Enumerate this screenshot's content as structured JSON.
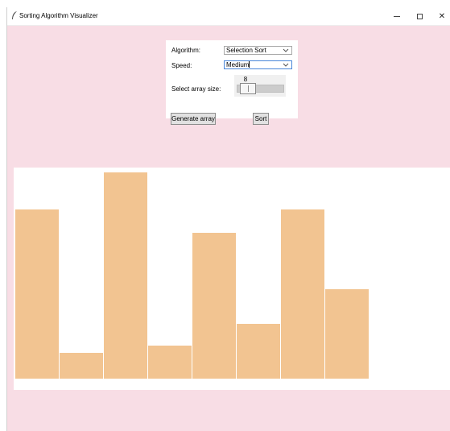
{
  "window": {
    "title": "Sorting Algorithm Visualizer",
    "icon": "feather-icon",
    "controls": {
      "minimize": "minimize-icon",
      "maximize": "maximize-icon",
      "close": "close-icon",
      "close_glyph": "✕"
    }
  },
  "controls": {
    "algorithm_label": "Algorithm:",
    "algorithm_value": "Selection Sort",
    "speed_label": "Speed:",
    "speed_value": "Medium",
    "array_size_label": "Select array size:",
    "array_size_value": "8",
    "array_size_fraction": 0.1,
    "generate_button": "Generate array",
    "sort_button": "Sort"
  },
  "colors": {
    "background": "#f8dde5",
    "bar": "#f2c491",
    "canvas": "#ffffff"
  },
  "array": {
    "values": [
      210,
      32,
      256,
      41,
      181,
      68,
      210,
      111
    ],
    "max": 256
  }
}
